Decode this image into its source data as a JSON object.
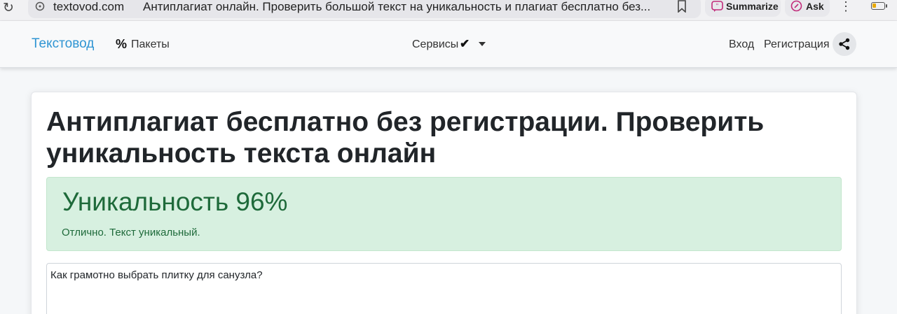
{
  "browser": {
    "domain": "textovod.com",
    "page_title": "Антиплагиат онлайн. Проверить большой текст на уникальность и плагиат бесплатно без...",
    "summarize_label": "Summarize",
    "ask_label": "Ask",
    "icons": [
      "reload-icon",
      "lock-icon",
      "bookmark-icon",
      "summarize-icon",
      "ask-icon",
      "more-menu-icon",
      "battery-icon"
    ]
  },
  "navbar": {
    "brand": "Текстовод",
    "packages_label": "Пакеты",
    "services_label": "Сервисы",
    "login_label": "Вход",
    "register_label": "Регистрация",
    "icons": [
      "percent-icon",
      "check-icon",
      "caret-down-icon",
      "share-icon"
    ]
  },
  "main": {
    "heading": "Антиплагиат бесплатно без регистрации. Проверить уникальность текста онлайн",
    "result": {
      "title": "Уникальность 96%",
      "message": "Отлично. Текст уникальный."
    },
    "text_input_value": "Как грамотно выбрать плитку для санузла?"
  },
  "colors": {
    "brand": "#2f95d3",
    "success_bg": "#d7f0e0",
    "success_text": "#1e6a3a"
  }
}
